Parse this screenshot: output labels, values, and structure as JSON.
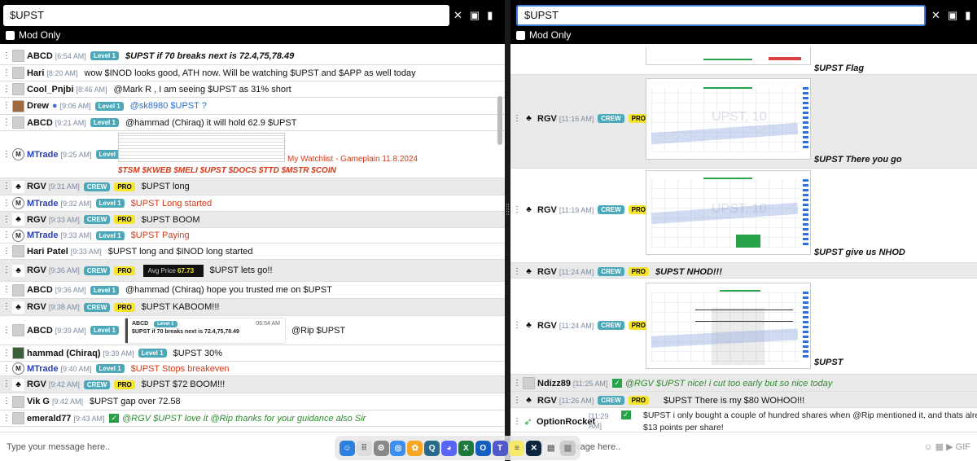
{
  "left": {
    "search": "$UPST",
    "mod_only": "Mod Only",
    "compose_placeholder": "Type your message here..",
    "messages": [
      {
        "name": "ABCD",
        "time": "[6:54 AM]",
        "badge": "Level 1",
        "text": "$UPST if 70 breaks next is 72.4,75,78.49"
      },
      {
        "name": "Hari",
        "time": "[8:20 AM]",
        "text": "wow $INOD looks good, ATH now. Will be watching $UPST and $APP as well today"
      },
      {
        "name": "Cool_Pnjbi",
        "time": "[8:46 AM]",
        "text": "@Mark R , I am seeing $UPST as 31% short"
      },
      {
        "name": "Drew",
        "time": "[9:06 AM]",
        "badge": "Level 1",
        "text": "@sk8980 $UPST ?"
      },
      {
        "name": "ABCD",
        "time": "[9:21 AM]",
        "badge": "Level 1",
        "text": "@hammad (Chiraq) it will hold 62.9 $UPST"
      },
      {
        "name": "MTrade",
        "time": "[9:25 AM]",
        "badge": "Level 1",
        "title": "My Watchlist - Gameplain 11.8.2024",
        "tickers": "$TSM $KWEB $MELI $UPST $DOCS $TTD $MSTR $COIN"
      },
      {
        "name": "RGV",
        "time": "[9:31 AM]",
        "badge": "CREW",
        "pro": "PRO",
        "text": "$UPST long"
      },
      {
        "name": "MTrade",
        "time": "[9:32 AM]",
        "badge": "Level 1",
        "text": "$UPST Long started"
      },
      {
        "name": "RGV",
        "time": "[9:33 AM]",
        "badge": "CREW",
        "pro": "PRO",
        "text": "$UPST BOOM"
      },
      {
        "name": "MTrade",
        "time": "[9:33 AM]",
        "badge": "Level 1",
        "text": "$UPST Paying"
      },
      {
        "name": "Hari Patel",
        "time": "[9:33 AM]",
        "text": "$UPST long and $INOD long started"
      },
      {
        "name": "RGV",
        "time": "[9:36 AM]",
        "badge": "CREW",
        "pro": "PRO",
        "avg_label": "Avg Price",
        "avg_value": "67.73",
        "text": "$UPST lets go!!"
      },
      {
        "name": "ABCD",
        "time": "[9:36 AM]",
        "badge": "Level 1",
        "text": "@hammad (Chiraq) hope you trusted me on $UPST"
      },
      {
        "name": "RGV",
        "time": "[9:38 AM]",
        "badge": "CREW",
        "pro": "PRO",
        "text": "$UPST KABOOM!!!"
      },
      {
        "name": "ABCD",
        "time": "[9:39 AM]",
        "badge": "Level 1",
        "quote_name": "ABCD",
        "quote_badge": "Level 1",
        "quote_time": "06:54 AM",
        "quote_text": "$UPST if 70 breaks next is 72.4,75,78.49",
        "text": "@Rip $UPST"
      },
      {
        "name": "hammad (Chiraq)",
        "time": "[9:39 AM]",
        "badge": "Level 1",
        "text": "$UPST 30%"
      },
      {
        "name": "MTrade",
        "time": "[9:40 AM]",
        "badge": "Level 1",
        "text": "$UPST Stops breakeven"
      },
      {
        "name": "RGV",
        "time": "[9:42 AM]",
        "badge": "CREW",
        "pro": "PRO",
        "text": "$UPST $72 BOOM!!!"
      },
      {
        "name": "Vik G",
        "time": "[9:42 AM]",
        "text": "$UPST gap over 72.58"
      },
      {
        "name": "emerald77",
        "time": "[9:43 AM]",
        "text": "@RGV $UPST love it @Rip thanks for your guidance also Sir"
      }
    ]
  },
  "right": {
    "search": "$UPST",
    "mod_only": "Mod Only",
    "compose_placeholder": "Type your message here..",
    "messages": [
      {
        "caption": "$UPST Flag"
      },
      {
        "name": "RGV",
        "time": "[11:16 AM]",
        "badge": "CREW",
        "pro": "PRO",
        "watermark": "UPST, 10",
        "caption": "$UPST There you go"
      },
      {
        "name": "RGV",
        "time": "[11:19 AM]",
        "badge": "CREW",
        "pro": "PRO",
        "watermark": "UPST, 10",
        "caption": "$UPST give us NHOD"
      },
      {
        "name": "RGV",
        "time": "[11:24 AM]",
        "badge": "CREW",
        "pro": "PRO",
        "text": "$UPST NHOD!!!"
      },
      {
        "name": "RGV",
        "time": "[11:24 AM]",
        "badge": "CREW",
        "pro": "PRO",
        "caption": "$UPST"
      },
      {
        "name": "Ndizz89",
        "time": "[11:25 AM]",
        "text": "@RGV $UPST nice! i cut too early but so nice today"
      },
      {
        "name": "RGV",
        "time": "[11:26 AM]",
        "badge": "CREW",
        "pro": "PRO",
        "text": "$UPST There is my $80 WOHOO!!!"
      },
      {
        "name": "OptionRocket",
        "time": "[11:29 AM]",
        "text1": "$UPST i only bought a couple of hundred shares when @Rip mentioned it, and thats already",
        "text2": "$13 points per share!"
      }
    ]
  },
  "dock": [
    "finder-icon",
    "launchpad-icon",
    "settings-icon",
    "safari-icon",
    "photos-icon",
    "quicktime-icon",
    "discord-icon",
    "excel-icon",
    "outlook-icon",
    "teams-icon",
    "notes-icon",
    "tradingview-icon",
    "preview-icon",
    "trash-icon"
  ]
}
